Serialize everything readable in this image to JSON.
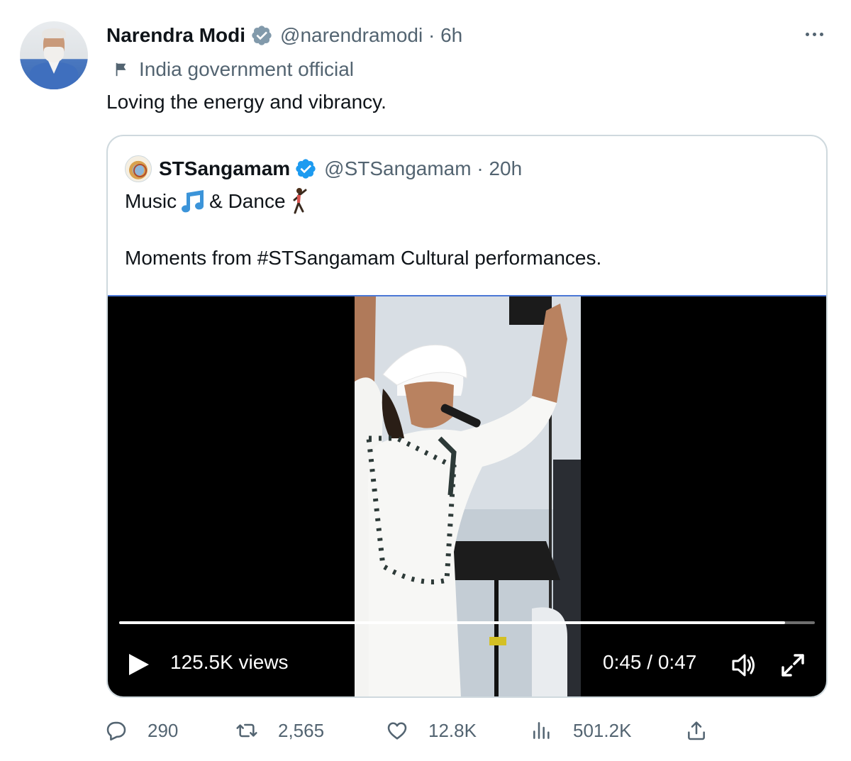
{
  "tweet": {
    "author_name": "Narendra Modi",
    "handle_time": "@narendramodi · 6h",
    "affiliation": "India government official",
    "text": "Loving the energy and vibrancy.",
    "more_label": "More"
  },
  "quoted": {
    "author_name": "STSangamam",
    "handle_time": "@STSangamam · 20h",
    "line1_a": "Music",
    "line1_b": "& Dance",
    "line2": "Moments from #STSangamam Cultural performances.",
    "video": {
      "views": "125.5K views",
      "time": "0:45 / 0:47",
      "progress": 0.957
    }
  },
  "actions": {
    "replies": "290",
    "reposts": "2,565",
    "likes": "12.8K",
    "views": "501.2K"
  },
  "colors": {
    "verified": "#1d9bf0",
    "secondary_text": "#536471",
    "border": "#cfd9de"
  },
  "icons": [
    "verified-badge-icon",
    "flag-icon",
    "more-icon",
    "music-note-icon",
    "dancer-icon",
    "play-icon",
    "volume-icon",
    "fullscreen-icon",
    "reply-icon",
    "repost-icon",
    "like-icon",
    "views-icon",
    "share-icon"
  ]
}
